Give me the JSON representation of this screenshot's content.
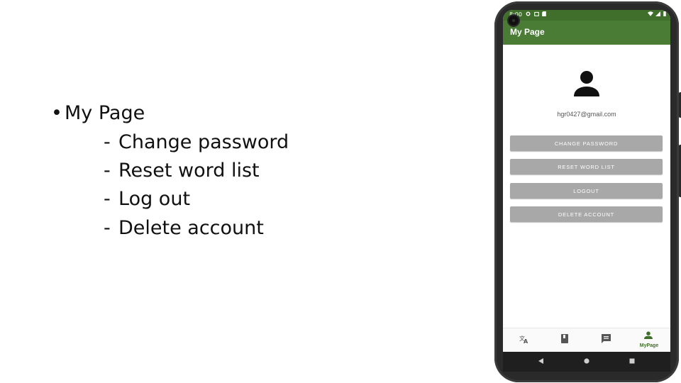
{
  "slide": {
    "main_bullet": "My Page",
    "bullet_glyph": "•",
    "dash_glyph": "-",
    "sub_items": [
      "Change password",
      "Reset word list",
      "Log out",
      "Delete account"
    ]
  },
  "phone": {
    "status_bar": {
      "time": "8:00",
      "icons": [
        "gear-icon",
        "notification-icon",
        "sd-card-icon"
      ],
      "right_icons": [
        "wifi-icon",
        "signal-icon",
        "battery-icon"
      ]
    },
    "app_bar": {
      "title": "My Page"
    },
    "profile": {
      "avatar_icon": "person-icon",
      "email": "hgr0427@gmail.com"
    },
    "buttons": {
      "change_password": "CHANGE PASSWORD",
      "reset_word_list": "RESET WORD LIST",
      "logout": "LOGOUT",
      "delete_account": "DELETE ACCOUNT"
    },
    "bottom_nav": [
      {
        "icon": "translate-icon",
        "label": "",
        "active": false
      },
      {
        "icon": "book-icon",
        "label": "",
        "active": false
      },
      {
        "icon": "chat-icon",
        "label": "",
        "active": false
      },
      {
        "icon": "person-icon",
        "label": "MyPage",
        "active": true
      }
    ],
    "system_nav": [
      "back-icon",
      "home-icon",
      "recents-icon"
    ],
    "colors": {
      "accent": "#4a7c36",
      "status_bar": "#3f6f2a",
      "button": "#a8a8a8"
    }
  }
}
